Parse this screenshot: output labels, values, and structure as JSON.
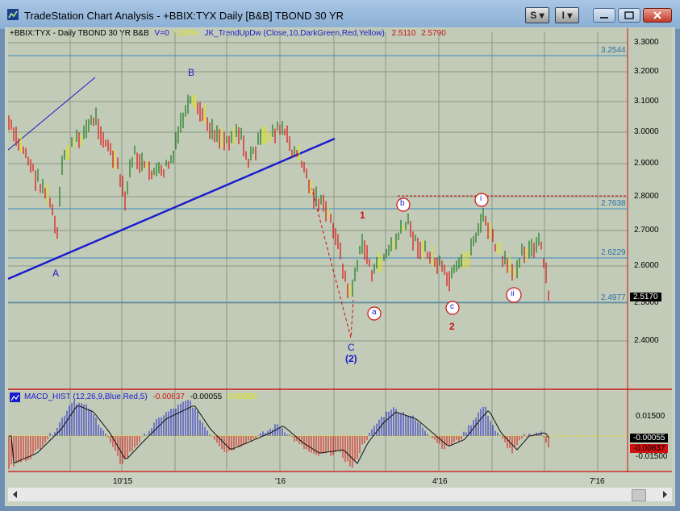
{
  "window": {
    "title": "TradeStation Chart Analysis - +BBIX:TYX Daily [B&B] TBOND 30 YR",
    "btn_s": "S",
    "btn_i": "I",
    "btn_arrow": "▾"
  },
  "header": {
    "symbol": "+BBIX:TYX - Daily  TBOND 30 YR  B&B",
    "volume": "V=0",
    "pct": "0.00%",
    "indicator": "JK_TrendUpDw (Close,10,DarkGreen,Red,Yellow)",
    "val1": "2.5110",
    "val2": "2.5790"
  },
  "macd": {
    "name": "MACD_HIST (12,26,9,Blue,Red,5)",
    "v1": "-0.00837",
    "v2": "-0.00055",
    "v3": "0.00000"
  },
  "price_axis": {
    "ticks": [
      "3.3000",
      "3.2000",
      "3.1000",
      "3.0000",
      "2.9000",
      "2.8000",
      "2.7000",
      "2.6000",
      "2.5000",
      "2.4000"
    ],
    "levels": [
      "3.2544",
      "2.7638",
      "2.6229",
      "2.4977"
    ],
    "last": "2.5170"
  },
  "macd_axis": {
    "ticks": [
      "0.01500",
      "-0.01500"
    ],
    "v_a": "-0.00055",
    "v_b": "-0.00837"
  },
  "date_axis": [
    "10'15",
    "'16",
    "4'16",
    "7'16"
  ],
  "wave_labels": {
    "A": "A",
    "B": "B",
    "C": "C",
    "C2": "(2)",
    "one": "1",
    "two": "2",
    "a": "a",
    "b": "b",
    "c": "c",
    "i": "i",
    "ii": "ii"
  },
  "colors": {
    "up": "#1c7a1c",
    "down": "#e01010",
    "neutral": "#e6e60a",
    "trend": "#1a1acf",
    "level": "#3a8ac0",
    "wave_red": "#d01010",
    "hist_up": "#2020d0",
    "hist_down": "#e01010"
  }
}
